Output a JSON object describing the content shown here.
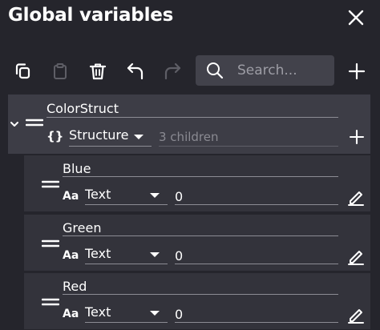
{
  "header": {
    "title": "Global variables",
    "close_icon": "close-icon"
  },
  "toolbar": {
    "icons": [
      "copy-icon",
      "paste-icon",
      "delete-icon",
      "undo-icon",
      "redo-icon",
      "add-icon"
    ],
    "search_placeholder": "Search..."
  },
  "structure": {
    "name": "ColorStruct",
    "type_label": "Structure",
    "children_count": "3 children",
    "children": [
      {
        "name": "Blue",
        "type": "Text",
        "value": "0"
      },
      {
        "name": "Green",
        "type": "Text",
        "value": "0"
      },
      {
        "name": "Red",
        "type": "Text",
        "value": "0"
      }
    ]
  },
  "colors": {
    "background": "#25252c",
    "structure_row": "#3d3d46",
    "child_row": "#33333b",
    "search_box": "#42424b",
    "icon_disabled": "#5e5e66"
  }
}
